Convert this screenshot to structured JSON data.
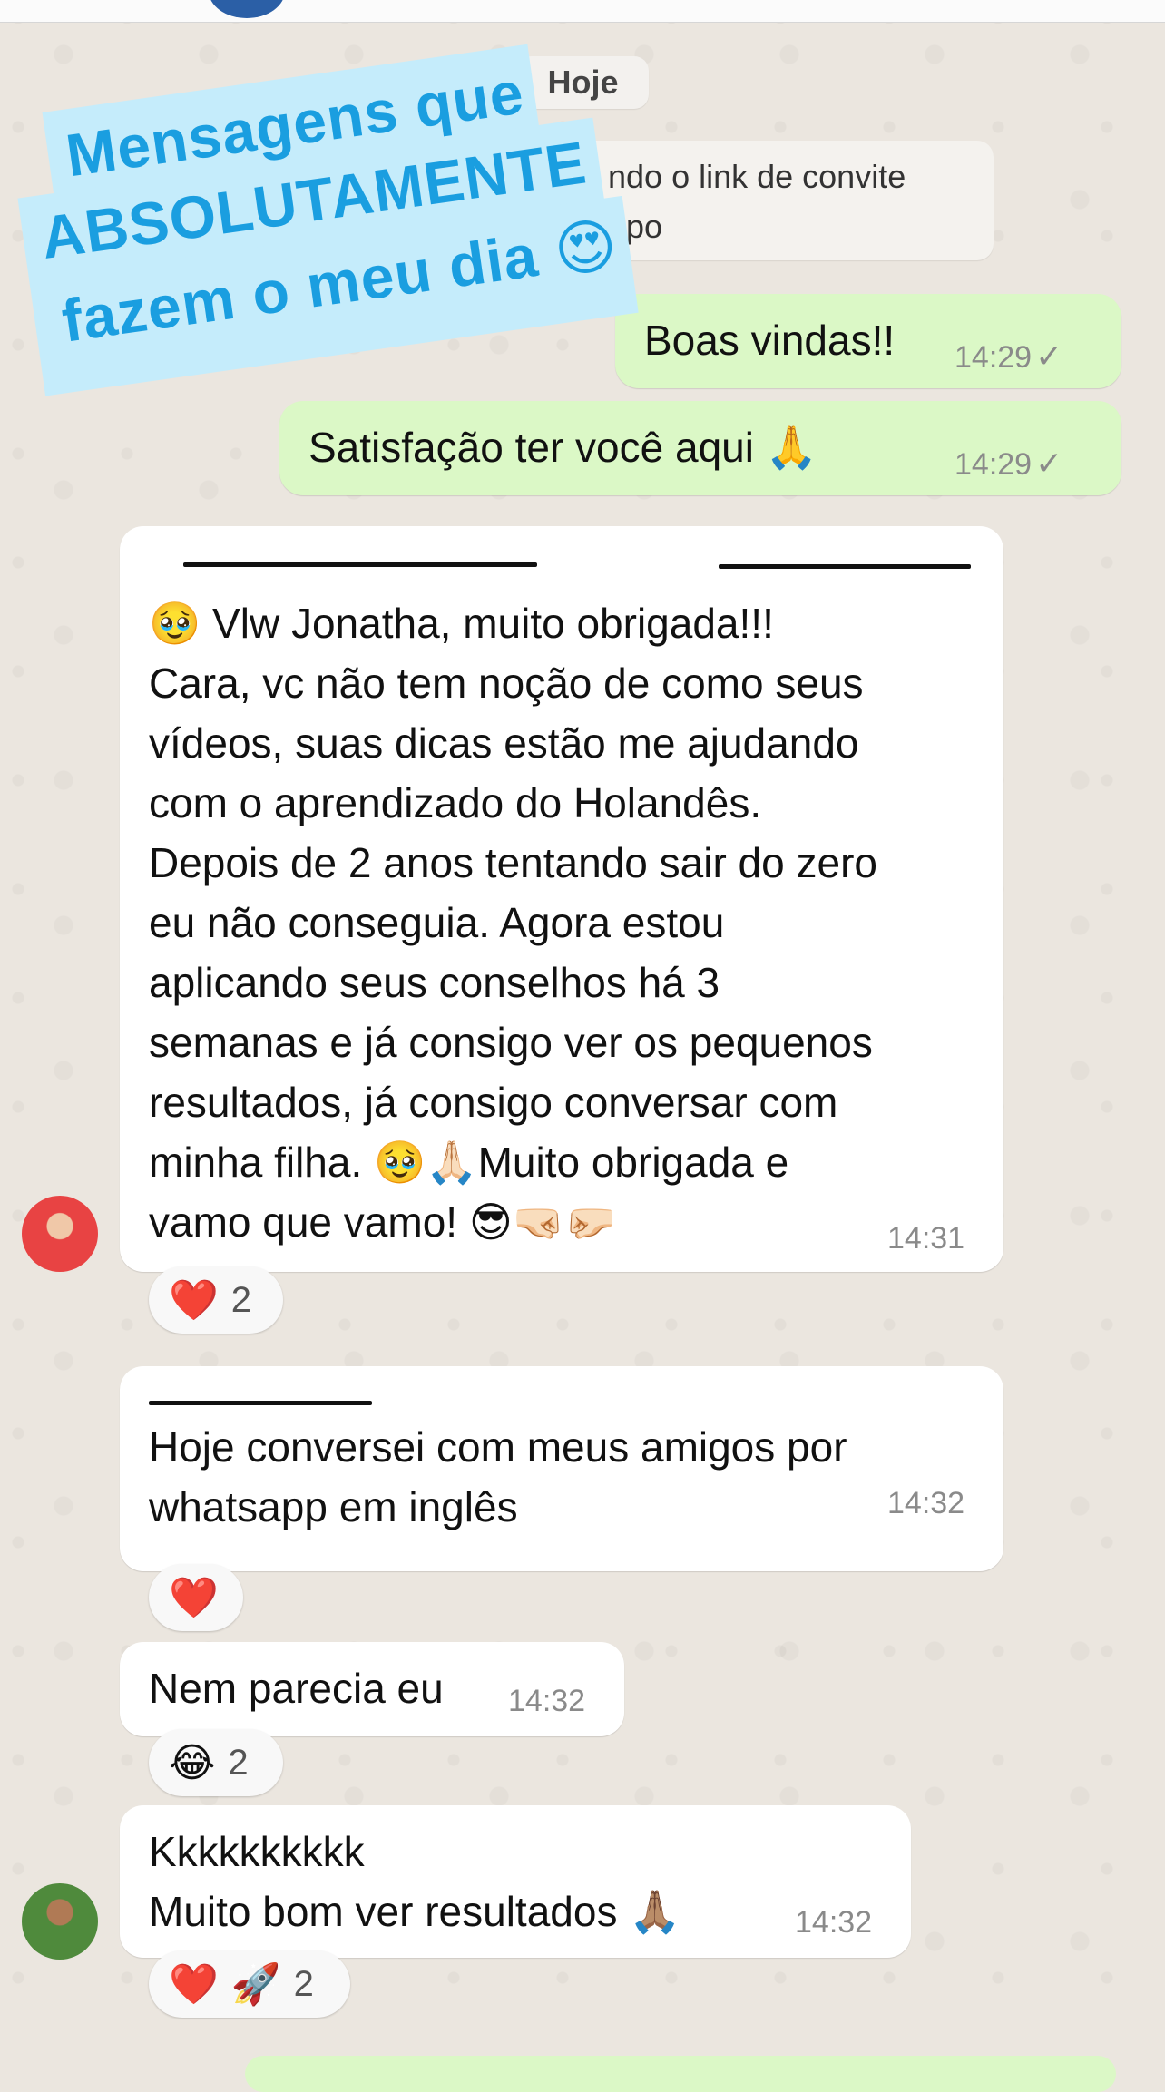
{
  "date_divider": "Hoje",
  "system_message": {
    "line1": "ndo o link de convite",
    "line2": "upo"
  },
  "overlay": {
    "line1": "Mensagens que",
    "line2": "ABSOLUTAMENTE",
    "line3": "fazem o meu dia 😍"
  },
  "messages": [
    {
      "text": "Boas vindas!!",
      "time": "14:29",
      "status": "✓"
    },
    {
      "text": "Satisfação ter você aqui 🙏",
      "time": "14:29",
      "status": "✓"
    },
    {
      "text": "🥹 Vlw Jonatha, muito obrigada!!!\nCara, vc não tem noção de como seus\nvídeos, suas dicas estão me ajudando\ncom o aprendizado do Holandês.\nDepois de 2 anos tentando sair do zero\neu não conseguia. Agora estou\naplicando seus conselhos há 3\nsemanas e já consigo ver os pequenos\nresultados, já consigo conversar com\nminha filha. 🥹🙏🏻Muito obrigada e\nvamo que vamo! 😎🤜🏻🤛🏻",
      "time": "14:31",
      "reaction_emoji": "❤️",
      "reaction_count": "2"
    },
    {
      "text": "Hoje conversei com meus amigos por\nwhatsapp em inglês",
      "time": "14:32",
      "reaction_emoji": "❤️"
    },
    {
      "text": "Nem parecia eu",
      "time": "14:32",
      "reaction_emoji": "😂",
      "reaction_count": "2"
    },
    {
      "text": "Kkkkkkkkkk\nMuito bom ver resultados 🙏🏽",
      "time": "14:32",
      "reaction_emoji": "❤️ 🚀",
      "reaction_count": "2"
    }
  ],
  "colors": {
    "outgoing_bubble": "#dbf8c6",
    "incoming_bubble": "#ffffff",
    "background": "#ebe6df",
    "overlay_bg": "#c5ecfb",
    "overlay_text": "#1a9ee0"
  }
}
